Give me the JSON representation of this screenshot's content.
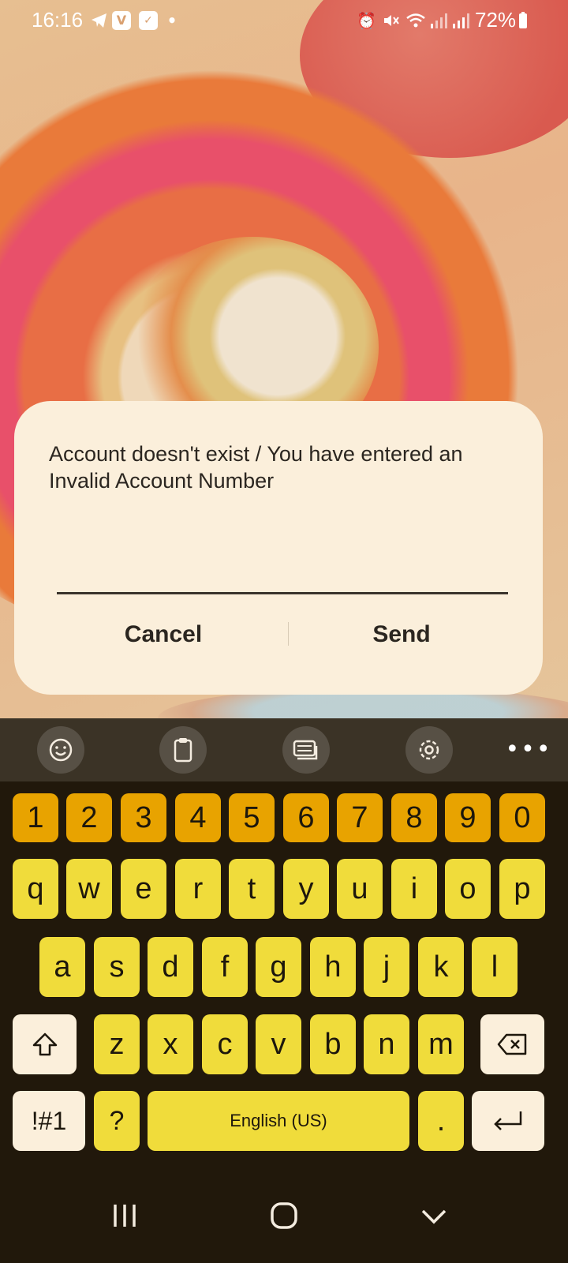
{
  "status_bar": {
    "time": "16:16",
    "battery_percent": "72%",
    "left_icons": [
      "telegram-icon",
      "vivaldi-icon",
      "task-check-icon",
      "dot-icon"
    ],
    "right_icons": [
      "alarm-icon",
      "mute-icon",
      "wifi-icon",
      "signal-icon",
      "signal-icon",
      "battery-icon"
    ]
  },
  "dialog": {
    "message": "Account doesn't exist / You have entered an Invalid Account Number",
    "input_value": "",
    "cancel_label": "Cancel",
    "send_label": "Send"
  },
  "keyboard": {
    "toolbar": [
      "emoji-icon",
      "clipboard-icon",
      "keyboard-mode-icon",
      "settings-icon",
      "more-icon"
    ],
    "number_row": [
      "1",
      "2",
      "3",
      "4",
      "5",
      "6",
      "7",
      "8",
      "9",
      "0"
    ],
    "row1": [
      "q",
      "w",
      "e",
      "r",
      "t",
      "y",
      "u",
      "i",
      "o",
      "p"
    ],
    "row2": [
      "a",
      "s",
      "d",
      "f",
      "g",
      "h",
      "j",
      "k",
      "l"
    ],
    "row3": [
      "z",
      "x",
      "c",
      "v",
      "b",
      "n",
      "m"
    ],
    "symbols_label": "!#1",
    "question_label": "?",
    "space_label": "English (US)",
    "period_label": ".",
    "colors": {
      "number_keys": "#e8a300",
      "letter_keys": "#f0dc3b",
      "special_keys": "#fbefdb",
      "background": "#21180b"
    }
  },
  "navigation": [
    "recents-icon",
    "home-icon",
    "back-icon"
  ]
}
